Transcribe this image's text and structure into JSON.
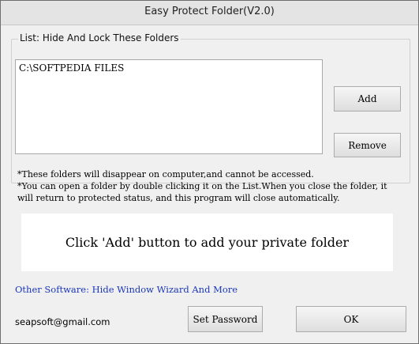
{
  "window": {
    "title": "Easy Protect Folder(V2.0)"
  },
  "group": {
    "label": "List: Hide And Lock These Folders",
    "items": [
      "C:\\SOFTPEDIA FILES"
    ],
    "add_label": "Add",
    "remove_label": "Remove"
  },
  "notes": [
    "*These folders will disappear on computer,and cannot be accessed.",
    "*You can open a folder by double clicking it on the List.When you close the folder, it",
    "will return to protected status, and this program will close automatically."
  ],
  "info": {
    "message": "Click 'Add' button to add your private folder"
  },
  "footer": {
    "other_software_link": "Other Software: Hide Window Wizard And More",
    "email": "seapsoft@gmail.com",
    "set_password_label": "Set Password",
    "ok_label": "OK"
  }
}
